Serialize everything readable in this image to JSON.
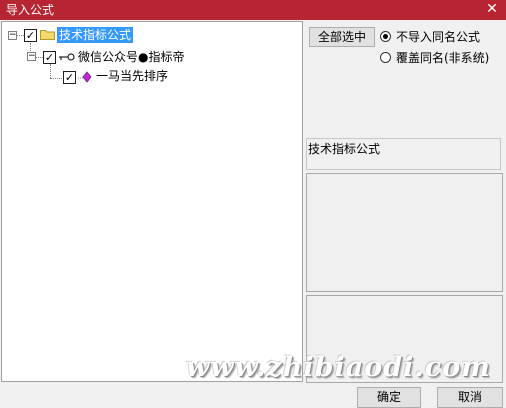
{
  "window": {
    "title": "导入公式",
    "close_glyph": "✕"
  },
  "tree": {
    "root": {
      "label": "技术指标公式",
      "checked": true,
      "expanded": true,
      "icon": "folder-icon",
      "expander_glyph": "−"
    },
    "author": {
      "label": "微信公众号●指标帝",
      "checked": true,
      "expanded": true,
      "icon": "key-icon",
      "expander_glyph": "−"
    },
    "formula": {
      "label": "一马当先排序",
      "checked": true,
      "icon": "diamond-formula-icon"
    }
  },
  "options": {
    "select_all_label": "全部选中",
    "radio_skip_label": "不导入同名公式",
    "radio_skip_selected": true,
    "radio_overwrite_label": "覆盖同名(非系统)",
    "radio_overwrite_selected": false
  },
  "info": {
    "category_text": "技术指标公式"
  },
  "footer": {
    "ok_label": "确定",
    "cancel_label": "取消"
  },
  "watermark": {
    "text": "www.zhibiaodi.com"
  },
  "colors": {
    "titlebar": "#b82532",
    "selection": "#3399ff",
    "folder": "#f5d76e",
    "diamond": "#c026d3"
  }
}
